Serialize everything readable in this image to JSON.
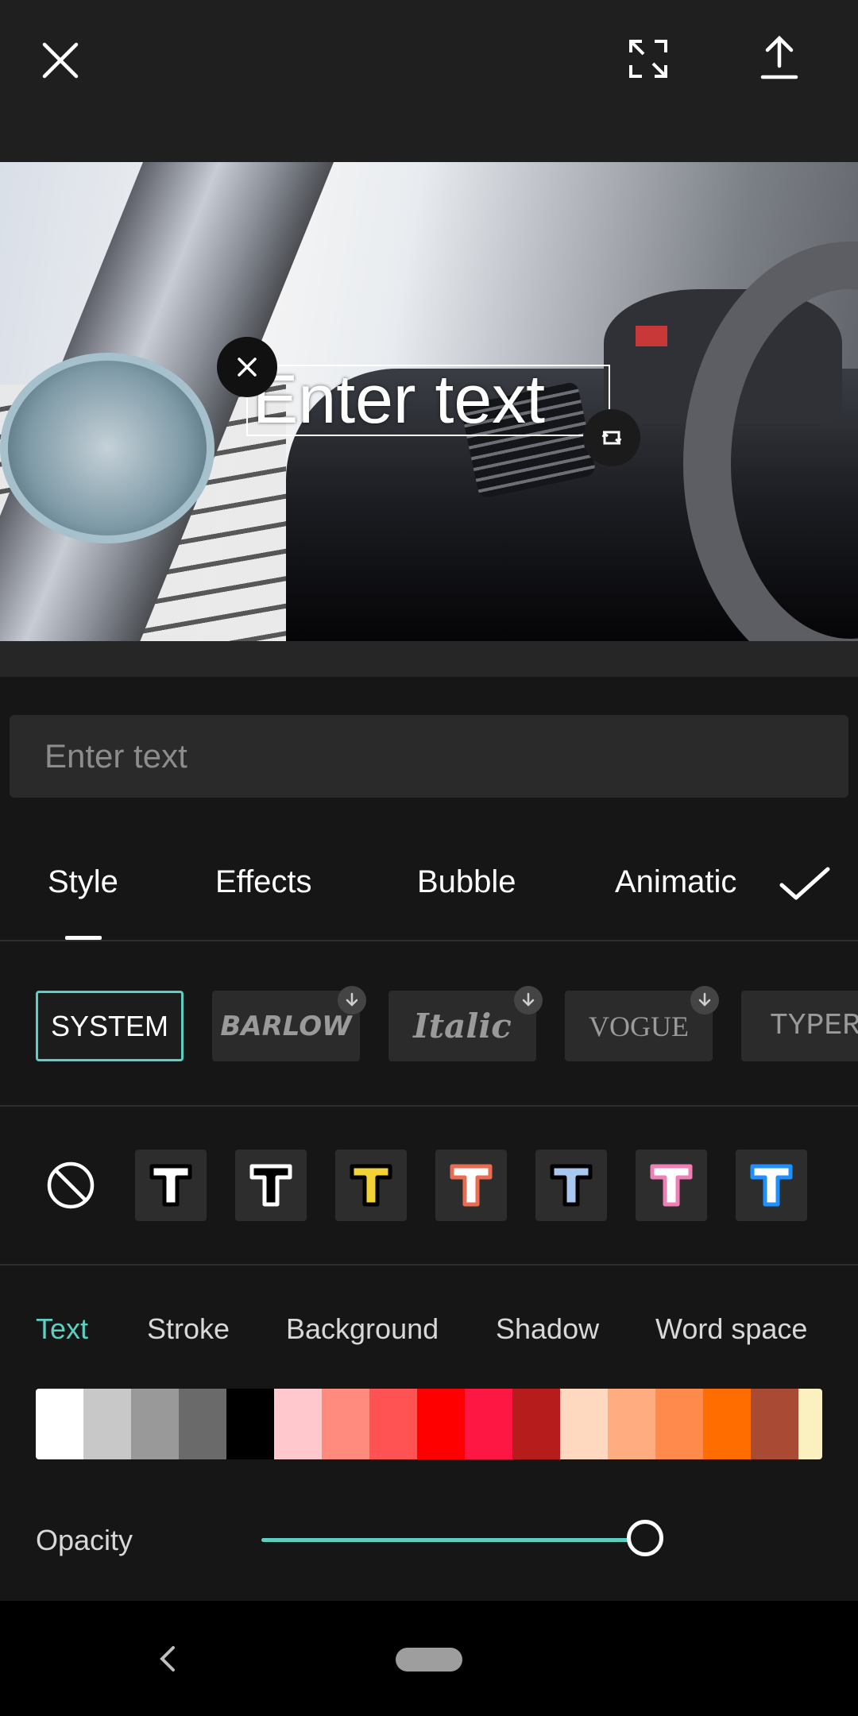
{
  "top_bar": {
    "icons": [
      "close-icon",
      "fullscreen-icon",
      "export-icon"
    ]
  },
  "preview": {
    "overlay_text": "Enter text",
    "icons": [
      "remove-text-icon",
      "rotate-resize-icon"
    ]
  },
  "text_input": {
    "placeholder": "Enter text",
    "value": ""
  },
  "tabs": {
    "items": [
      {
        "label": "Style",
        "selected": true
      },
      {
        "label": "Effects"
      },
      {
        "label": "Bubble"
      },
      {
        "label": "Animatic"
      }
    ],
    "confirm_icon": "checkmark-icon"
  },
  "fonts": {
    "items": [
      {
        "label": "SYSTEM",
        "selected": true,
        "downloadable": false
      },
      {
        "label": "BARLOW",
        "downloadable": true
      },
      {
        "label": "Italic",
        "downloadable": true
      },
      {
        "label": "VOGUE",
        "downloadable": true
      },
      {
        "label": "TYPER",
        "downloadable": false
      }
    ]
  },
  "style_presets": {
    "none_icon": "no-style-icon",
    "items": [
      {
        "fill": "#ffffff",
        "stroke": "#000000"
      },
      {
        "fill": "#000000",
        "stroke": "#ffffff"
      },
      {
        "fill": "#f2d234",
        "stroke": "#000000"
      },
      {
        "fill": "#ffffff",
        "stroke": "#ea6a52"
      },
      {
        "fill": "#a9c8f0",
        "stroke": "#000000"
      },
      {
        "fill": "#ffffff",
        "stroke": "#f07fb6"
      },
      {
        "fill": "#ffffff",
        "stroke": "#1e90ff"
      }
    ]
  },
  "sub_tabs": {
    "items": [
      "Text",
      "Stroke",
      "Background",
      "Shadow",
      "Word space"
    ],
    "selected": "Text"
  },
  "palette": {
    "colors": [
      "#ffffff",
      "#c8c8c8",
      "#999999",
      "#6a6a6a",
      "#000000",
      "#ffc8cc",
      "#ff8a7e",
      "#ff5252",
      "#ff0000",
      "#ff1744",
      "#b71c1c",
      "#ffd8c0",
      "#ffad80",
      "#ff8a4c",
      "#ff6d00",
      "#a94a35",
      "#fbf0c0"
    ]
  },
  "opacity": {
    "label": "Opacity",
    "value": 1.0
  },
  "nav_bar": {
    "icons": [
      "back-icon",
      "home-pill-icon"
    ]
  }
}
